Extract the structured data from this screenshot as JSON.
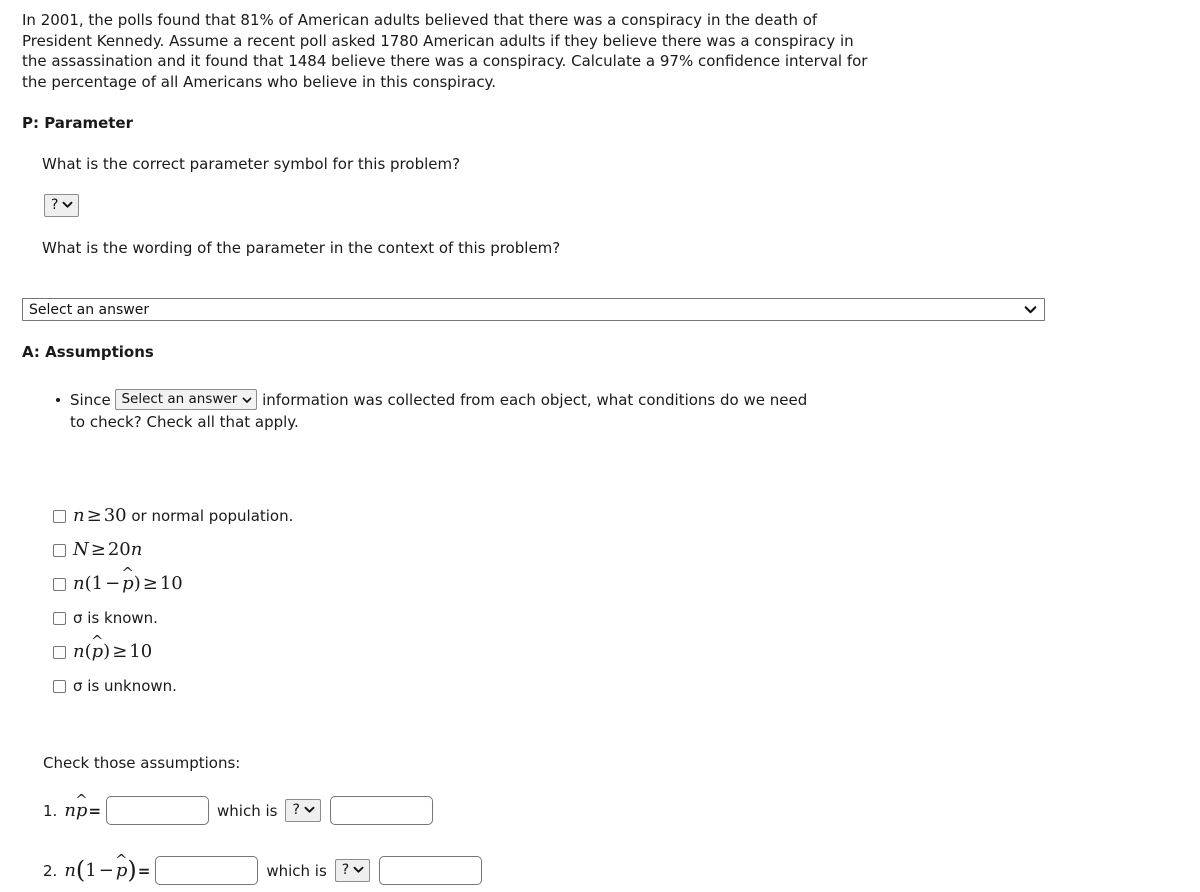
{
  "problem": {
    "text": "In 2001, the polls found that 81% of American adults believed that there was a conspiracy in the death of President Kennedy. Assume a recent poll asked 1780 American adults if they believe there was a conspiracy in the assassination and it found that 1484 believe there was a conspiracy.  Calculate a 97% confidence interval for the percentage of all Americans who believe in this conspiracy."
  },
  "parameter_section": {
    "heading": "P: Parameter",
    "prompt_symbol": "What is the correct parameter symbol for this problem?",
    "symbol_select_value": "?",
    "prompt_wording": "What is the wording of the parameter in the context of this problem?",
    "wording_select_value": "Select an answer"
  },
  "assumptions_section": {
    "heading": "A: Assumptions",
    "bullet_prefix": "Since",
    "bullet_select_value": "Select an answer",
    "bullet_suffix_line1": "information was collected from each object, what conditions do we need",
    "bullet_suffix_line2": "to check?  Check all that apply.",
    "checkboxes": [
      {
        "id": "n-ge-30",
        "label": "n ≥ 30 or normal population.",
        "checked": false
      },
      {
        "id": "N-ge-20n",
        "label": "N ≥ 20n",
        "checked": false
      },
      {
        "id": "n-1-minus-phat-ge-10",
        "label": "n(1 − p̂) ≥ 10",
        "checked": false
      },
      {
        "id": "sigma-known",
        "label": "σ is known.",
        "checked": false
      },
      {
        "id": "n-phat-ge-10",
        "label": "n(p̂) ≥ 10",
        "checked": false
      },
      {
        "id": "sigma-unknown",
        "label": "σ is unknown.",
        "checked": false
      }
    ]
  },
  "check_section": {
    "label": "Check those assumptions:",
    "rows": [
      {
        "number": "1.",
        "expression": "np̂=",
        "value": "",
        "which_is": "which is",
        "comparison_select_value": "?",
        "threshold_value": ""
      },
      {
        "number": "2.",
        "expression": "n(1 − p̂)=",
        "value": "",
        "which_is": "which is",
        "comparison_select_value": "?",
        "threshold_value": ""
      }
    ]
  },
  "icons": {
    "chevron_down": "chevron-down-icon"
  },
  "colors": {
    "page_background": "#ffffff",
    "text": "#1a1a1a",
    "control_border": "#767676",
    "select_background": "#efefef",
    "input_background": "#ffffff"
  }
}
